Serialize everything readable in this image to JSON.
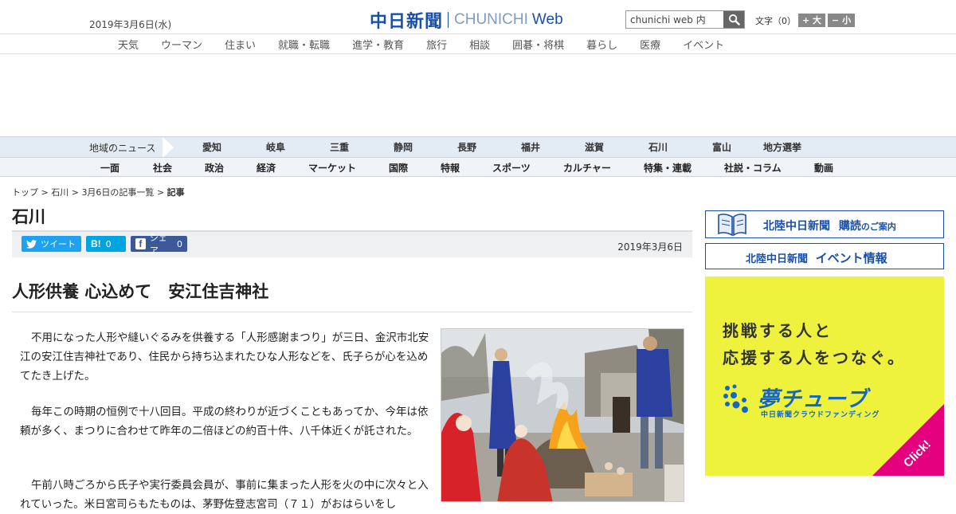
{
  "header": {
    "date": "2019年3月6日(水)",
    "logo_jp": "中日新聞",
    "logo_en_1": "CHUNICHI",
    "logo_en_2": "Web",
    "search_value": "chunichi web 内",
    "font_size_label": "文字（0）",
    "font_bigger": "+ 大",
    "font_smaller": "− 小"
  },
  "top_nav": [
    "天気",
    "ウーマン",
    "住まい",
    "就職・転職",
    "進学・教育",
    "旅行",
    "相談",
    "囲碁・将棋",
    "暮らし",
    "医療",
    "イベント"
  ],
  "regional_nav": {
    "label": "地域のニュース",
    "items": [
      "愛知",
      "岐阜",
      "三重",
      "静岡",
      "長野",
      "福井",
      "滋賀",
      "石川",
      "富山",
      "地方選挙"
    ]
  },
  "category_nav": [
    "一面",
    "社会",
    "政治",
    "経済",
    "マーケット",
    "国際",
    "特報",
    "スポーツ",
    "カルチャー",
    "特集・連載",
    "社説・コラム",
    "動画"
  ],
  "breadcrumb": {
    "top": "トップ",
    "region": "石川",
    "list": "3月6日の記事一覧",
    "current": "記事",
    "sep": ">"
  },
  "section_title": "石川",
  "share": {
    "tweet": "ツイート",
    "hatena_count": "0",
    "fb_label": "シェア",
    "fb_count": "0",
    "date": "2019年3月6日"
  },
  "article": {
    "headline": "人形供養 心込めて　安江住吉神社",
    "paragraphs": [
      "不用になった人形や縫いぐるみを供養する「人形感謝まつり」が三日、金沢市北安江の安江住吉神社であり、住民から持ち込まれたひな人形などを、氏子らが心を込めてたき上げた。",
      "毎年この時期の恒例で十八回目。平成の終わりが近づくこともあってか、今年は依頼が多く、まつりに合わせて昨年の二倍ほどの約百十件、八千体近くが託された。",
      "午前八時ごろから氏子や実行委員会員が、事前に集まった人形を火の中に次々と入れていった。米日宮司らもたものは、茅野佐登志宮司（７１）がおはらいをし"
    ]
  },
  "sidebar": {
    "ad1_text": "北陸中日新聞",
    "ad1_bold": "購読",
    "ad1_small": "のご案内",
    "ad2_text": "北陸中日新聞",
    "ad2_bold": "イベント情報",
    "ad3_line1": "挑戦する人と",
    "ad3_line2": "応援する人をつなぐ。",
    "ad3_brand": "夢チューブ",
    "ad3_sub": "中日新聞クラウドファンディング",
    "ad3_click": "Click!"
  },
  "colors": {
    "brand_blue": "#1a4fa8",
    "twitter": "#1da1f2",
    "hatena": "#00a4de",
    "facebook": "#3b5998",
    "ad_yellow": "#eef23c",
    "ad_pink": "#e4007f"
  }
}
